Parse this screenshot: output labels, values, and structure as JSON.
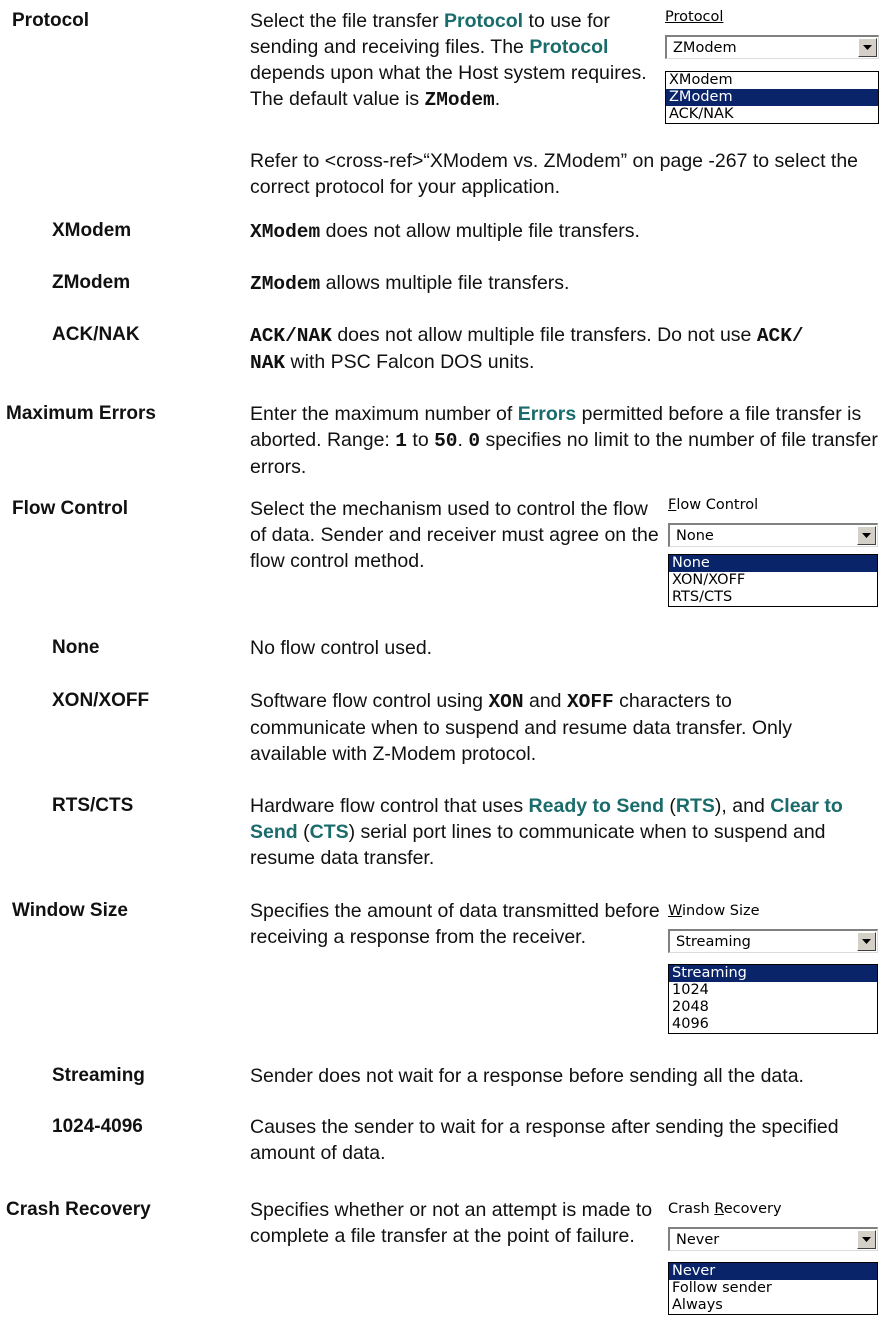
{
  "protocol": {
    "term": "Protocol",
    "desc_1": "Select the file transfer ",
    "desc_hl1": "Protocol",
    "desc_2": " to use for sending and receiving files. The ",
    "desc_hl2": "Protocol",
    "desc_3": " depends upon what the Host system requires. The default value is ",
    "desc_code": "ZModem",
    "desc_4": ".",
    "xref": "Refer to <cross-ref>“XModem vs. ZModem” on page -267 to select the correct protocol for your application.",
    "widget": {
      "label": "Protocol",
      "selected": "ZModem",
      "options": [
        "XModem",
        "ZModem",
        "ACK/NAK"
      ]
    },
    "subs": [
      {
        "term": "XModem",
        "code": "XModem",
        "text": " does not allow multiple file transfers."
      },
      {
        "term": "ZModem",
        "code": "ZModem",
        "text": " allows multiple file transfers."
      },
      {
        "term": "ACK/NAK",
        "code": "ACK/NAK",
        "text_1": " does not allow multiple file transfers. Do not use ",
        "code2": "ACK/ NAK",
        "text_2": " with PSC Falcon DOS units."
      }
    ]
  },
  "max_errors": {
    "term": "Maximum Errors",
    "t1": "Enter the maximum number of ",
    "hl": "Errors",
    "t2": " permitted before a file transfer is aborted. Range: ",
    "c1": "1",
    "t3": " to ",
    "c2": "50",
    "t4": ". ",
    "c3": "0",
    "t5": " specifies no limit to the number of file transfer errors."
  },
  "flow_control": {
    "term": "Flow Control",
    "desc": "Select the mechanism used to control the flow of data. Sender and receiver must agree on the flow control method.",
    "widget": {
      "label_pre": "",
      "label_u": "F",
      "label_post": "low Control",
      "selected": "None",
      "options": [
        "None",
        "XON/XOFF",
        "RTS/CTS"
      ]
    },
    "subs": {
      "none": {
        "term": "None",
        "text": "No flow control used."
      },
      "xon": {
        "term": "XON/XOFF",
        "t1": "Software flow control using ",
        "c1": "XON",
        "t2": " and ",
        "c2": "XOFF",
        "t3": " characters to communicate when to suspend and resume data transfer. Only available with Z-Modem protocol."
      },
      "rts": {
        "term": "RTS/CTS",
        "t1": "Hardware flow control that uses ",
        "h1": "Ready to Send",
        "t2": " (",
        "h2": "RTS",
        "t3": "), and ",
        "h3": "Clear to Send",
        "t4": " (",
        "h4": "CTS",
        "t5": ") serial port lines to communicate when to suspend and resume data transfer."
      }
    }
  },
  "window_size": {
    "term": "Window Size",
    "desc": "Specifies the amount of data transmitted before receiving a response from the receiver.",
    "widget": {
      "label_pre": "",
      "label_u": "W",
      "label_post": "indow Size",
      "selected": "Streaming",
      "options": [
        "Streaming",
        "1024",
        "2048",
        "4096"
      ]
    },
    "subs": {
      "streaming": {
        "term": "Streaming",
        "text": "Sender does not wait for a response before sending all the data."
      },
      "range": {
        "term": "1024-4096",
        "text": "Causes the sender to wait for a response after sending the specified amount of data."
      }
    }
  },
  "crash_recovery": {
    "term": "Crash Recovery",
    "desc": "Specifies whether or not an attempt is made to complete a file transfer at the point of failure.",
    "widget": {
      "label_pre": "Crash ",
      "label_u": "R",
      "label_post": "ecovery",
      "selected": "Never",
      "options": [
        "Never",
        "Follow sender",
        "Always"
      ]
    }
  }
}
